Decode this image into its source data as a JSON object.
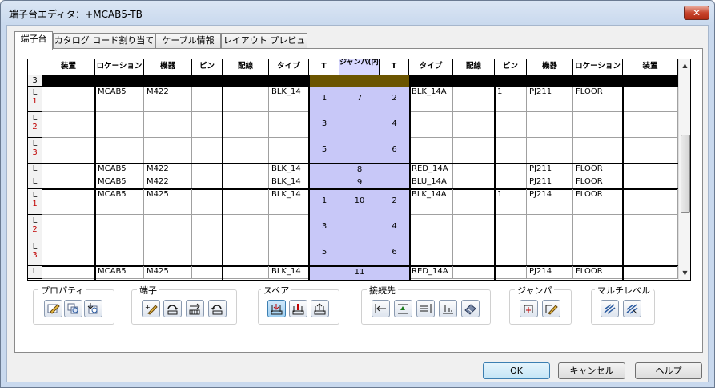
{
  "window": {
    "title": "端子台エディタ：+MCAB5-TB",
    "close_label": "✕"
  },
  "tabs": [
    {
      "label": "端子台"
    },
    {
      "label": "カタログ コード割り当て"
    },
    {
      "label": "ケーブル情報"
    },
    {
      "label": "レイアウト プレビュー"
    }
  ],
  "grid": {
    "headers": [
      "装置",
      "ロケーション",
      "機器",
      "ピン",
      "配線",
      "タイプ",
      "T",
      "ジャンパ(内部)",
      "T",
      "タイプ",
      "配線",
      "ピン",
      "機器",
      "ロケーション",
      "装置"
    ],
    "left_group_rows": [
      {
        "row": "L 1",
        "loc": "MCAB5",
        "dev": "M422",
        "type": "BLK_14",
        "t1": "1",
        "jmp": "7",
        "t2": "2",
        "rtype": "BLK_14A",
        "rpin": "1",
        "rdev": "PJ211",
        "rloc": "FLOOR"
      },
      {
        "row": "L 2",
        "t1": "3",
        "t2": "4"
      },
      {
        "row": "L 3",
        "t1": "5",
        "t2": "6"
      }
    ],
    "single_rows": [
      {
        "row": "L",
        "loc": "MCAB5",
        "dev": "M422",
        "type": "BLK_14",
        "jmp": "8",
        "rtype": "RED_14A",
        "rdev": "PJ211",
        "rloc": "FLOOR"
      },
      {
        "row": "L",
        "loc": "MCAB5",
        "dev": "M422",
        "type": "BLK_14",
        "jmp": "9",
        "rtype": "BLU_14A",
        "rdev": "PJ211",
        "rloc": "FLOOR"
      }
    ],
    "second_group_rows": [
      {
        "row": "L 1",
        "loc": "MCAB5",
        "dev": "M425",
        "type": "BLK_14",
        "t1": "1",
        "jmp": "10",
        "t2": "2",
        "rtype": "BLK_14A",
        "rpin": "1",
        "rdev": "PJ214",
        "rloc": "FLOOR"
      },
      {
        "row": "L 2",
        "t1": "3",
        "t2": "4"
      },
      {
        "row": "L 3",
        "t1": "5",
        "t2": "6"
      }
    ],
    "last_row": {
      "row": "L",
      "loc": "MCAB5",
      "dev": "M425",
      "type": "BLK_14",
      "jmp": "11",
      "rtype": "RED_14A",
      "rdev": "PJ214",
      "rloc": "FLOOR"
    },
    "top_row_label": "3"
  },
  "toolbar_groups": [
    {
      "label": "プロパティ",
      "icons": [
        "properties-edit-icon",
        "properties-copy-icon",
        "properties-flip-icon"
      ]
    },
    {
      "label": "端子",
      "icons": [
        "terminal-edit-icon",
        "terminal-rotate-icon",
        "terminal-move-icon",
        "terminal-rotate-alt-icon"
      ]
    },
    {
      "label": "スペア",
      "icons": [
        "spare-add-icon",
        "spare-insert-icon",
        "spare-remove-icon"
      ]
    },
    {
      "label": "接続先",
      "icons": [
        "dest-align-left-icon",
        "dest-align-top-icon",
        "dest-align-right-icon",
        "dest-align-bottom-icon",
        "dest-eraser-icon"
      ]
    },
    {
      "label": "ジャンパ",
      "icons": [
        "jumper-add-icon",
        "jumper-edit-icon"
      ]
    },
    {
      "label": "マルチレベル",
      "icons": [
        "multilevel-expand-icon",
        "multilevel-collapse-icon"
      ]
    }
  ],
  "buttons": {
    "ok": "OK",
    "cancel": "キャンセル",
    "help": "ヘルプ"
  }
}
